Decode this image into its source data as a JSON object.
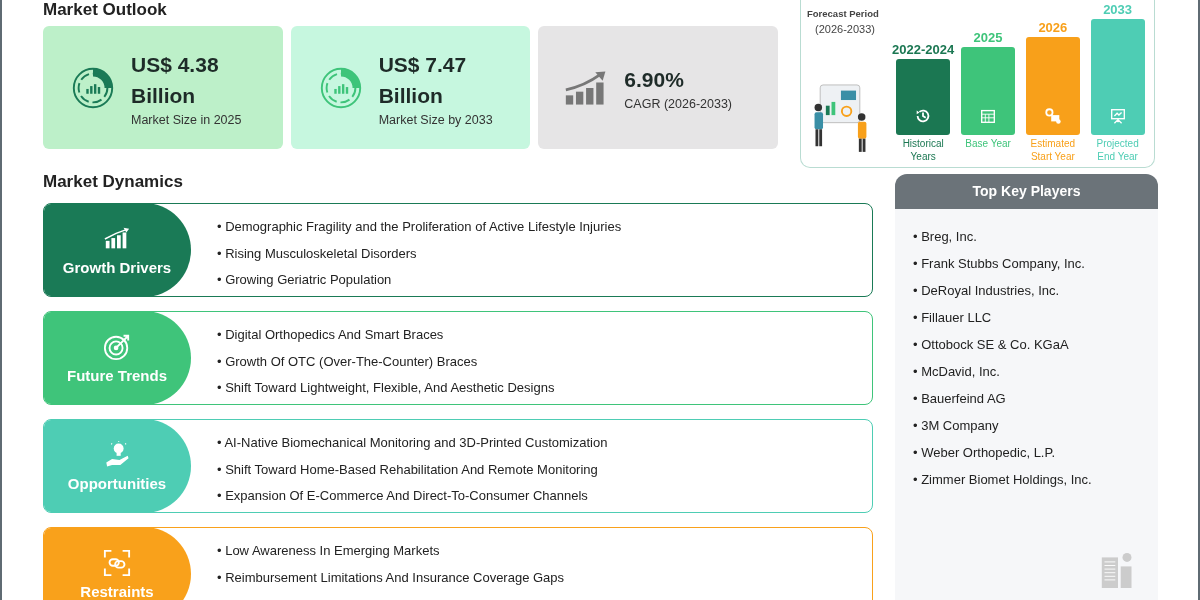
{
  "outlook": {
    "title": "Market Outlook",
    "cards": [
      {
        "kind": "donut",
        "value": "US$ 4.38",
        "unit": "Billion",
        "caption": "Market Size in 2025",
        "color": "#bdf0c9"
      },
      {
        "kind": "donut",
        "value": "US$ 7.47",
        "unit": "Billion",
        "caption": "Market Size by 2033",
        "color": "#c6f7df"
      },
      {
        "kind": "growth",
        "value": "6.90%",
        "caption": "CAGR (2026-2033)",
        "color": "#e6e5e6"
      }
    ]
  },
  "forecast": {
    "title": "Forecast Period",
    "subtitle": "(2026-2033)",
    "periods": [
      {
        "year": "2022-2024",
        "label": "Historical Years",
        "kind": "history",
        "color": "#1b7752"
      },
      {
        "year": "2025",
        "label": "Base Year",
        "kind": "calendar",
        "color": "#3ec47a"
      },
      {
        "year": "2026",
        "label": "Estimated Start Year",
        "kind": "estimate",
        "color": "#f8a01a"
      },
      {
        "year": "2033",
        "label": "Projected End Year",
        "kind": "projection",
        "color": "#4ecdb4"
      }
    ]
  },
  "dynamics": {
    "title": "Market Dynamics",
    "groups": [
      {
        "name": "Growth Drivers",
        "kind": "growth",
        "color": "#1a7a56",
        "items": [
          "• Demographic Fragility and the Proliferation of Active Lifestyle Injuries",
          "• Rising Musculoskeletal Disorders",
          "• Growing Geriatric Population"
        ]
      },
      {
        "name": "Future Trends",
        "kind": "target",
        "color": "#3fc47a",
        "items": [
          "• Digital Orthopedics And Smart Braces",
          "• Growth Of OTC (Over-The-Counter) Braces",
          "• Shift Toward Lightweight, Flexible, And Aesthetic Designs"
        ]
      },
      {
        "name": "Opportunities",
        "kind": "idea",
        "color": "#4ecdb4",
        "items": [
          "• AI-Native Biomechanical Monitoring and 3D-Printed Customization",
          "• Shift Toward Home-Based Rehabilitation And Remote Monitoring",
          "• Expansion Of E-Commerce And Direct-To-Consumer Channels"
        ]
      },
      {
        "name": "Restraints",
        "kind": "link",
        "color": "#f9a11b",
        "items": [
          "• Low Awareness In Emerging Markets",
          "• Reimbursement Limitations And Insurance Coverage Gaps"
        ]
      }
    ]
  },
  "players": {
    "title": "Top Key Players",
    "items": [
      "• Breg, Inc.",
      "• Frank Stubbs Company, Inc.",
      "• DeRoyal Industries, Inc.",
      "• Fillauer LLC",
      "• Ottobock SE & Co. KGaA",
      "• McDavid, Inc.",
      "• Bauerfeind AG",
      "• 3M Company",
      "• Weber Orthopedic, L.P.",
      "• Zimmer Biomet Holdings, Inc."
    ]
  }
}
